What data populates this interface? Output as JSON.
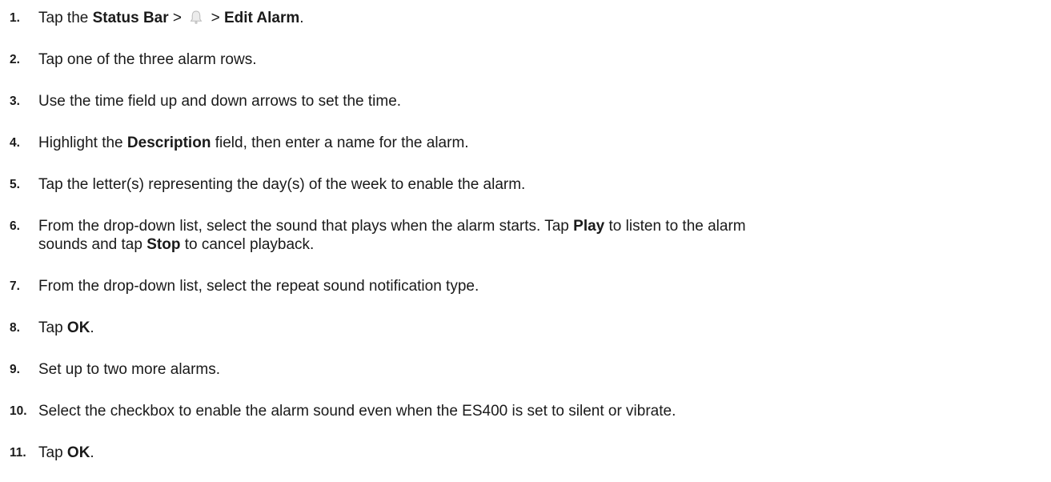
{
  "steps": [
    {
      "num": "1.",
      "a": "Tap the ",
      "b1": "Status Bar",
      "c": " > ",
      "icon": "bell-icon",
      "d": " > ",
      "b2": "Edit Alarm",
      "e": "."
    },
    {
      "num": "2.",
      "text": "Tap one of the three alarm rows."
    },
    {
      "num": "3.",
      "text": "Use the time field up and down arrows to set the time."
    },
    {
      "num": "4.",
      "a": "Highlight the ",
      "b1": "Description",
      "c": " field, then enter a name for the alarm."
    },
    {
      "num": "5.",
      "text": "Tap the letter(s) representing the day(s) of the week to enable the alarm."
    },
    {
      "num": "6.",
      "a": "From the drop-down list, select the sound that plays when the alarm starts. Tap ",
      "b1": "Play",
      "c": " to listen to the alarm",
      "d": "sounds and tap ",
      "b2": "Stop",
      "e": " to cancel playback."
    },
    {
      "num": "7.",
      "text": "From the drop-down list, select the repeat sound notification type."
    },
    {
      "num": "8.",
      "a": "Tap ",
      "b1": "OK",
      "c": "."
    },
    {
      "num": "9.",
      "text": "Set up to two more alarms."
    },
    {
      "num": "10.",
      "text": "Select the checkbox to enable the alarm sound even when the ES400 is set to silent or vibrate."
    },
    {
      "num": "11.",
      "a": "Tap ",
      "b1": "OK",
      "c": "."
    }
  ]
}
